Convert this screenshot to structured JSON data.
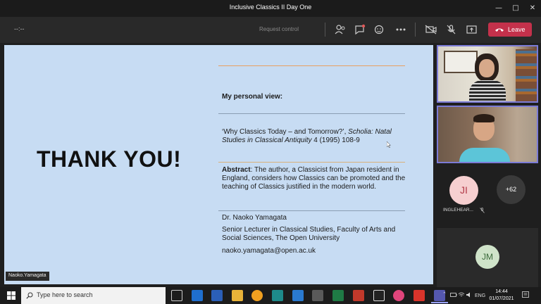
{
  "window": {
    "title": "Inclusive Classics II Day One"
  },
  "toolbar": {
    "timer": "--:--",
    "request_control": "Request control",
    "leave_label": "Leave"
  },
  "slide": {
    "thank_you": "THANK YOU!",
    "view_heading": "My personal view:",
    "citation_part1": "‘Why Classics Today – and Tomorrow?’, ",
    "citation_journal": "Scholia: Natal Studies in Classical Antiquity",
    "citation_part2": " 4 (1995) 108-9",
    "abstract_label": "Abstract",
    "abstract_text": ": The author, a Classicist from Japan resident in England, considers how Classics can be promoted and the teaching of Classics justified in the modern world.",
    "author_name": "Dr. Naoko Yamagata",
    "author_role": "Senior Lecturer in Classical Studies, Faculty of Arts and Social Sciences, The Open University",
    "author_email": "naoko.yamagata@open.ac.uk"
  },
  "presenter_label": "Naoko.Yamagata",
  "participants": {
    "ji_initials": "JI",
    "ji_name": "INGLEHEAR...",
    "more_count": "+62",
    "jm_initials": "JM"
  },
  "taskbar": {
    "search_placeholder": "Type here to search",
    "language": "ENG",
    "time": "14:44",
    "date": "01/07/2021"
  },
  "colors": {
    "leave": "#c4314b",
    "slide_bg": "#c7dcf3",
    "tile_border": "#7b7bd6",
    "accent_line": "#e8a060"
  }
}
